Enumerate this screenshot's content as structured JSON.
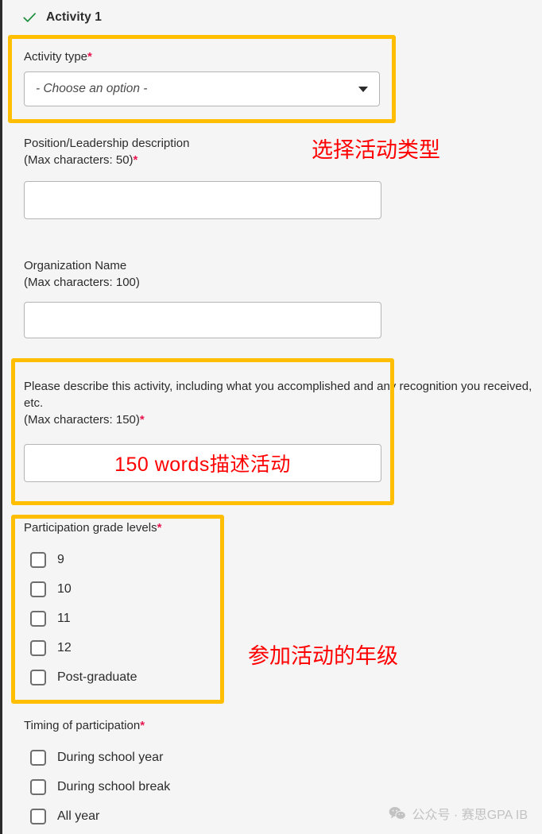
{
  "header": {
    "check_icon": "green-check-icon",
    "title": "Activity 1"
  },
  "colors": {
    "highlight": "#FFBF00",
    "annotation_red": "#FF0000",
    "required_asterisk": "#E8174F",
    "page_background": "#F5F5F5",
    "check_green": "#1E8E3E"
  },
  "fields": {
    "activity_type": {
      "label": "Activity type",
      "required": true,
      "select_value": "- Choose an option -",
      "caret_icon": "chevron-down-icon"
    },
    "position": {
      "label": "Position/Leadership description\n(Max characters: 50)",
      "required": true,
      "value": "",
      "placeholder": ""
    },
    "organization": {
      "label": "Organization Name\n(Max characters: 100)",
      "required": false,
      "value": "",
      "placeholder": ""
    },
    "describe": {
      "label": "Please describe this activity, including what you accomplished and any recognition you received, etc.\n(Max characters: 150)",
      "required": true,
      "value": "150 words描述活动",
      "placeholder": ""
    }
  },
  "grade_levels": {
    "label": "Participation grade levels",
    "required": true,
    "options": [
      {
        "label": "9",
        "checked": false
      },
      {
        "label": "10",
        "checked": false
      },
      {
        "label": "11",
        "checked": false
      },
      {
        "label": "12",
        "checked": false
      },
      {
        "label": "Post-graduate",
        "checked": false
      }
    ]
  },
  "timing": {
    "label": "Timing of participation",
    "required": true,
    "options": [
      {
        "label": "During school year",
        "checked": false
      },
      {
        "label": "During school break",
        "checked": false
      },
      {
        "label": "All year",
        "checked": false
      }
    ]
  },
  "annotations": [
    {
      "text": "选择活动类型",
      "target": "activity-type"
    },
    {
      "text": "参加活动的年级",
      "target": "grade-levels"
    }
  ],
  "watermark": {
    "icon": "wechat-icon",
    "text": "公众号 · 赛思GPA IB"
  }
}
